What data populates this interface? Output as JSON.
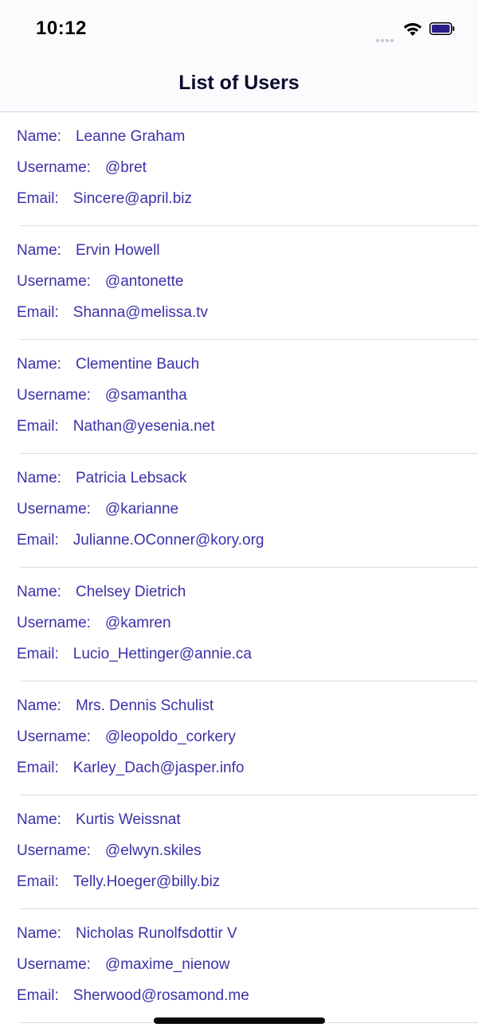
{
  "status_bar": {
    "time": "10:12",
    "icons": [
      "cellular-signal-icon",
      "wifi-icon",
      "battery-icon"
    ]
  },
  "nav": {
    "title": "List of Users"
  },
  "labels": {
    "name": "Name:",
    "username": "Username:",
    "email": "Email:"
  },
  "colors": {
    "text_accent": "#3b32a8",
    "title": "#0b0b2e",
    "divider": "#dadae6"
  },
  "users": [
    {
      "name": "Leanne Graham",
      "username": "@bret",
      "email": "Sincere@april.biz"
    },
    {
      "name": "Ervin Howell",
      "username": "@antonette",
      "email": "Shanna@melissa.tv"
    },
    {
      "name": "Clementine Bauch",
      "username": "@samantha",
      "email": "Nathan@yesenia.net"
    },
    {
      "name": "Patricia Lebsack",
      "username": "@karianne",
      "email": "Julianne.OConner@kory.org"
    },
    {
      "name": "Chelsey Dietrich",
      "username": "@kamren",
      "email": "Lucio_Hettinger@annie.ca"
    },
    {
      "name": "Mrs. Dennis Schulist",
      "username": "@leopoldo_corkery",
      "email": "Karley_Dach@jasper.info"
    },
    {
      "name": "Kurtis Weissnat",
      "username": "@elwyn.skiles",
      "email": "Telly.Hoeger@billy.biz"
    },
    {
      "name": "Nicholas Runolfsdottir V",
      "username": "@maxime_nienow",
      "email": "Sherwood@rosamond.me"
    }
  ]
}
